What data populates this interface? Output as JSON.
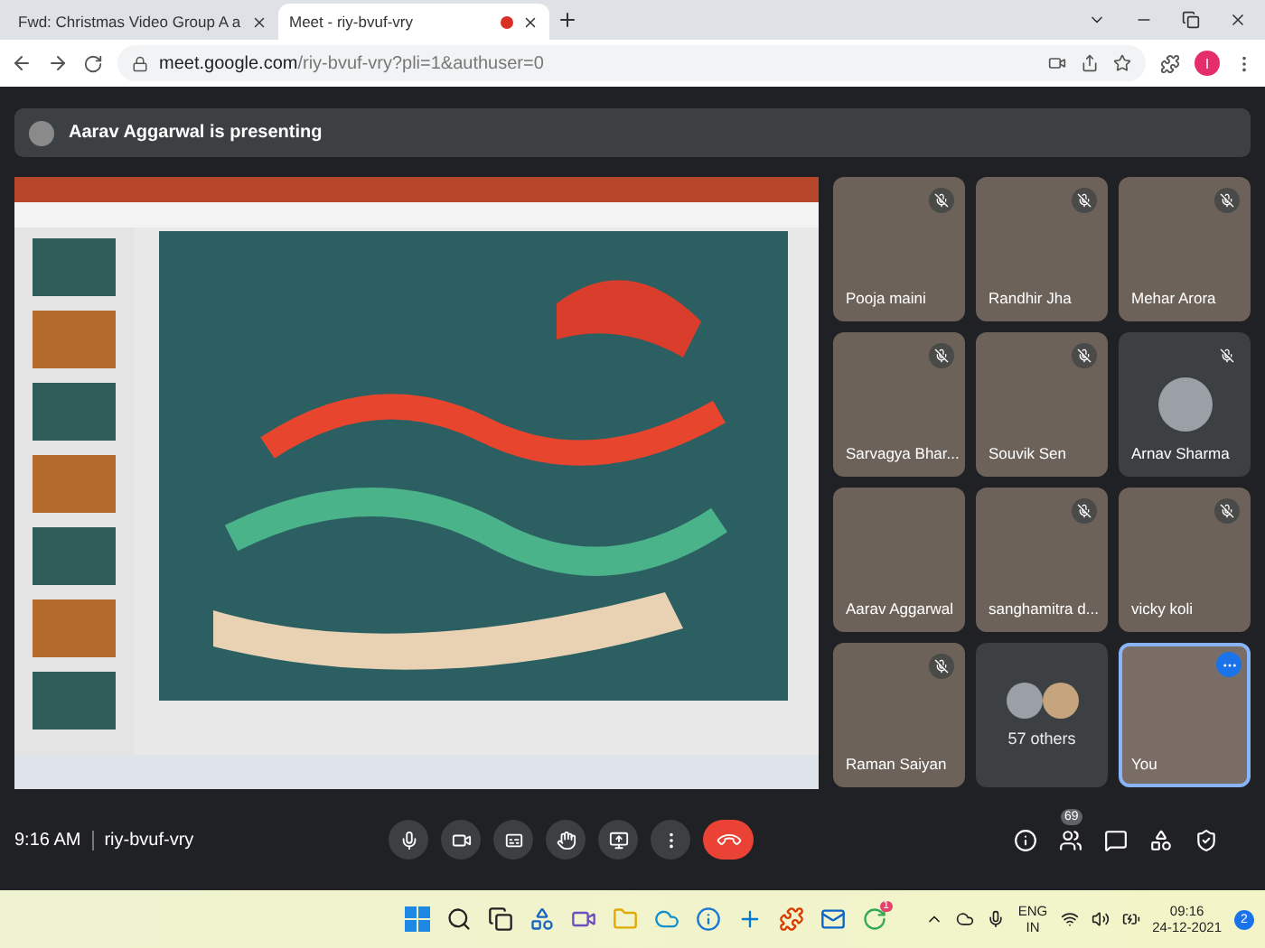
{
  "browser": {
    "tabs": [
      {
        "title": "Fwd: Christmas Video Group A a",
        "selected": false,
        "recording": false
      },
      {
        "title": "Meet - riy-bvuf-vry",
        "selected": true,
        "recording": true
      }
    ],
    "url_host": "meet.google.com",
    "url_path": "/riy-bvuf-vry?pli=1&authuser=0",
    "profile_initial": "I"
  },
  "banner": {
    "text": "Aarav Aggarwal is presenting"
  },
  "tiles": [
    {
      "kind": "video",
      "name": "Pooja maini",
      "muted": true,
      "highlighted": false
    },
    {
      "kind": "video",
      "name": "Randhir Jha",
      "muted": true,
      "highlighted": false
    },
    {
      "kind": "video",
      "name": "Mehar Arora",
      "muted": true,
      "highlighted": false
    },
    {
      "kind": "video",
      "name": "Sarvagya Bhar...",
      "muted": true,
      "highlighted": false
    },
    {
      "kind": "video",
      "name": "Souvik Sen",
      "muted": true,
      "highlighted": false
    },
    {
      "kind": "avatar",
      "name": "Arnav Sharma",
      "muted": true,
      "highlighted": false
    },
    {
      "kind": "video",
      "name": "Aarav Aggarwal",
      "muted": false,
      "highlighted": false
    },
    {
      "kind": "video",
      "name": "sanghamitra d...",
      "muted": true,
      "highlighted": false
    },
    {
      "kind": "video",
      "name": "vicky koli",
      "muted": true,
      "highlighted": false
    },
    {
      "kind": "video",
      "name": "Raman Saiyan",
      "muted": true,
      "highlighted": false
    },
    {
      "kind": "others",
      "name": "57 others",
      "muted": false,
      "highlighted": false
    },
    {
      "kind": "self",
      "name": "You",
      "muted": false,
      "highlighted": true
    }
  ],
  "meeting_bar": {
    "time": "9:16 AM",
    "code": "riy-bvuf-vry",
    "participant_count": "69"
  },
  "taskbar": {
    "language": "ENG",
    "region": "IN",
    "time": "09:16",
    "date": "24-12-2021",
    "notifications": "2",
    "chrome_badge": "1"
  }
}
